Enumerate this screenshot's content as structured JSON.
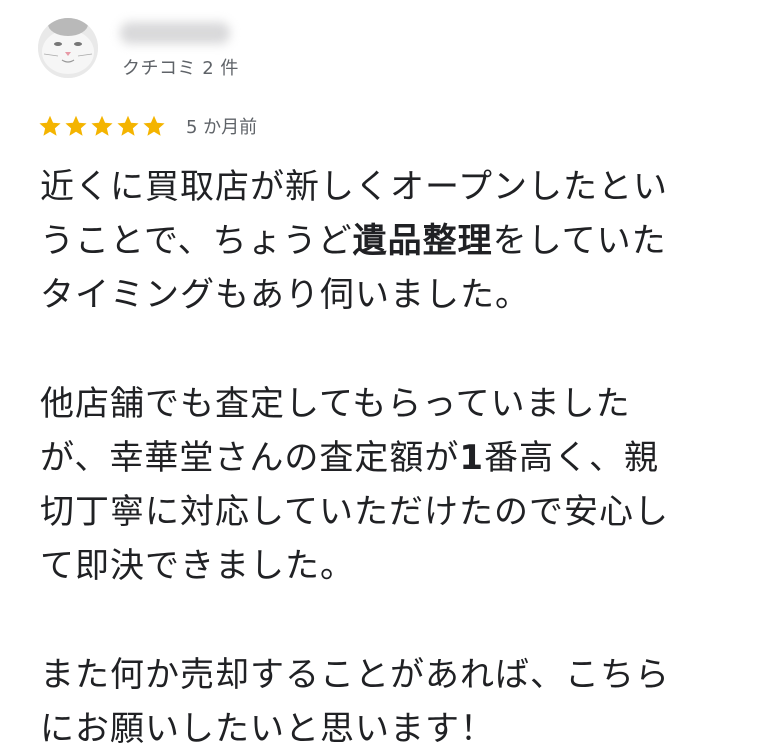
{
  "reviewer": {
    "review_count": "クチコミ 2 件"
  },
  "rating": {
    "value": 5,
    "max": 5,
    "star_color": "#f4b400",
    "time_ago": "5 か月前"
  },
  "review": {
    "paragraph1": {
      "line1": "近くに買取店が新しくオープンしたとい",
      "line2_before": "うことで、ちょうど",
      "line2_highlight": "遺品整理",
      "line2_after": "をしていた",
      "line3": "タイミングもあり伺いました。"
    },
    "paragraph2": {
      "line1": "他店舗でも査定してもらっていました",
      "line2_before": "が、幸華堂さんの査定額が",
      "line2_highlight": "1",
      "line2_after": "番高く、親",
      "line3": "切丁寧に対応していただけたので安心し",
      "line4": "て即決できました。"
    },
    "paragraph3": {
      "line1": "また何か売却することがあれば、こちら",
      "line2": "にお願いしたいと思います！"
    }
  }
}
